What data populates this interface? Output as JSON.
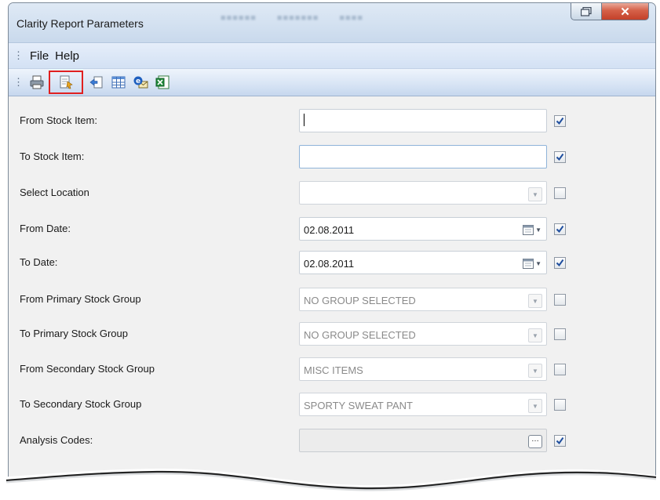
{
  "window": {
    "title": "Clarity Report Parameters"
  },
  "menu": {
    "items": [
      "File",
      "Help"
    ]
  },
  "toolbar": {
    "buttons": [
      "print-icon",
      "preview-icon",
      "export-icon",
      "grid-icon",
      "email-icon",
      "excel-icon"
    ]
  },
  "params": [
    {
      "label": "From Stock Item:",
      "value": "",
      "kind": "text",
      "checked": true
    },
    {
      "label": "To Stock Item:",
      "value": "",
      "kind": "text",
      "checked": true
    },
    {
      "label": "Select Location",
      "value": "",
      "kind": "dropdown",
      "checked": false
    },
    {
      "label": "From Date:",
      "value": "02.08.2011",
      "kind": "date",
      "checked": true
    },
    {
      "label": "To Date:",
      "value": "02.08.2011",
      "kind": "date",
      "checked": true
    },
    {
      "label": "From Primary Stock Group",
      "value": "NO GROUP SELECTED",
      "kind": "dropdown",
      "checked": false
    },
    {
      "label": "To Primary Stock Group",
      "value": "NO GROUP SELECTED",
      "kind": "dropdown",
      "checked": false
    },
    {
      "label": "From Secondary Stock Group",
      "value": "MISC ITEMS",
      "kind": "dropdown",
      "checked": false
    },
    {
      "label": "To Secondary Stock Group",
      "value": "SPORTY SWEAT PANT",
      "kind": "dropdown",
      "checked": false
    },
    {
      "label": "Analysis Codes:",
      "value": "",
      "kind": "lookup",
      "checked": true
    }
  ],
  "colors": {
    "check_blue": "#1f4e9e",
    "highlight_red": "#e02020",
    "close_red": "#c4412a"
  }
}
